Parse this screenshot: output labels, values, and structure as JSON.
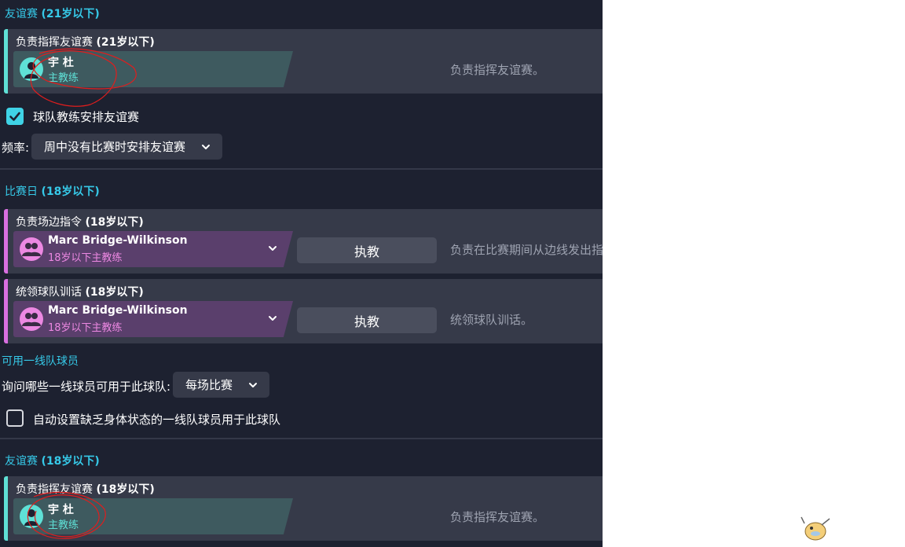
{
  "sections": {
    "friendly_u21": {
      "title": "友谊赛",
      "age": "(21岁以下)"
    },
    "matchday_u18": {
      "title": "比赛日",
      "age": "(18岁以下)"
    },
    "first_team": {
      "title": "可用一线队球员"
    },
    "friendly_u18": {
      "title": "友谊赛",
      "age": "(18岁以下)"
    }
  },
  "cards": {
    "friendly_u21": {
      "title": "负责指挥友谊赛",
      "age": "(21岁以下)",
      "person_name": "宇 杜",
      "person_role": "主教练",
      "description": "负责指挥友谊赛。"
    },
    "touchline_u18": {
      "title": "负责场边指令",
      "age": "(18岁以下)",
      "person_name": "Marc Bridge-Wilkinson",
      "person_role": "18岁以下主教练",
      "button": "执教",
      "description": "负责在比赛期间从边线发出指令。"
    },
    "training_u18": {
      "title": "统领球队训话",
      "age": "(18岁以下)",
      "person_name": "Marc Bridge-Wilkinson",
      "person_role": "18岁以下主教练",
      "button": "执教",
      "description": "统领球队训话。"
    },
    "friendly_u18": {
      "title": "负责指挥友谊赛",
      "age": "(18岁以下)",
      "person_name": "宇 杜",
      "person_role": "主教练",
      "description": "负责指挥友谊赛。"
    }
  },
  "friendly_settings": {
    "checkbox_label": "球队教练安排友谊赛",
    "checkbox_checked": true,
    "frequency_label": "频率:",
    "frequency_value": "周中没有比赛时安排友谊赛"
  },
  "first_team_settings": {
    "ask_label": "询问哪些一线球员可用于此球队:",
    "ask_value": "每场比赛",
    "auto_label": "自动设置缺乏身体状态的一线队球员用于此球队",
    "auto_checked": false
  },
  "colors": {
    "panel_bg": "#1d2130",
    "card_bg": "#363a49",
    "accent_cyan": "#36c9e8",
    "teal_bar": "#5fe0d6",
    "pink_bar": "#d86fe0"
  },
  "icons": {
    "person": "person-silhouette-icon",
    "group": "people-group-icon",
    "check": "checkmark-icon",
    "chevron": "chevron-down-icon",
    "tray_bird": "bird-mascot-icon"
  }
}
